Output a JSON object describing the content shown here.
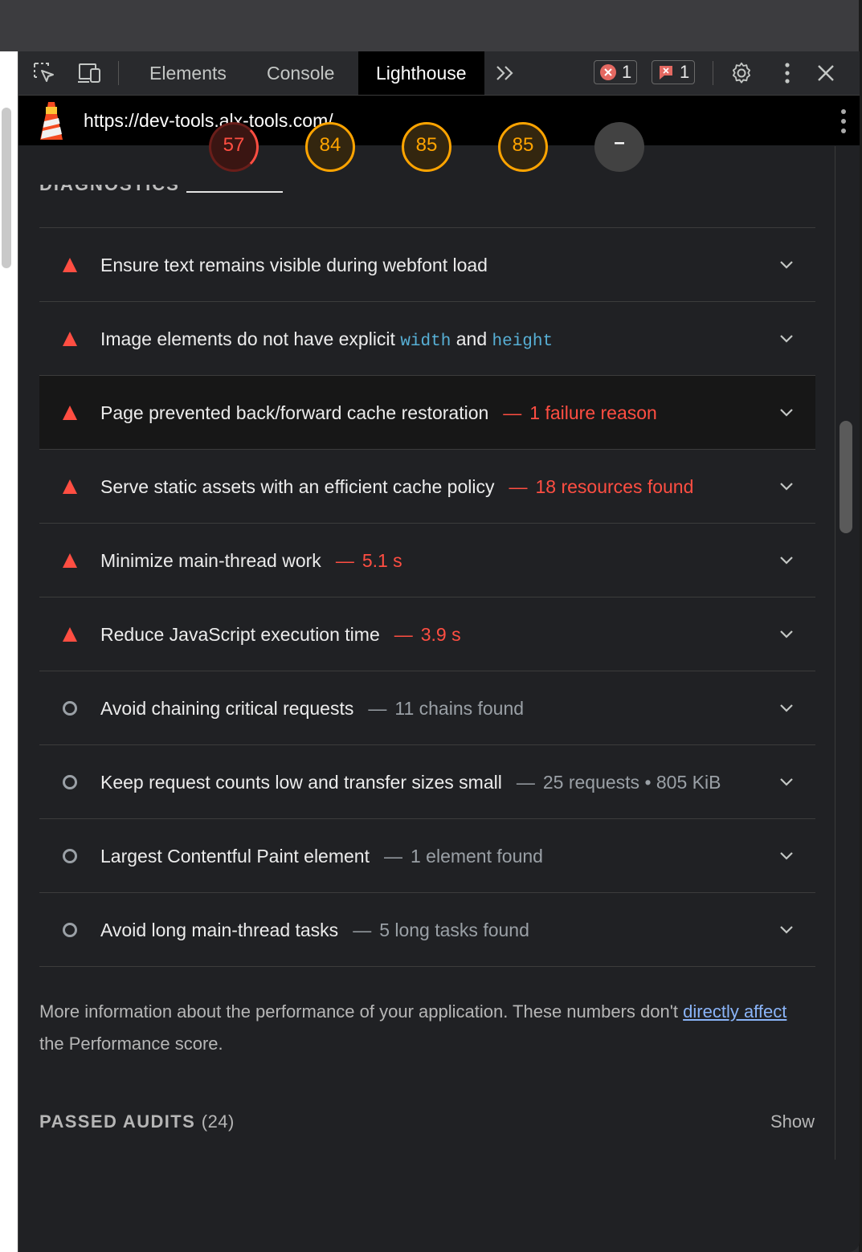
{
  "tabs": [
    {
      "label": "Elements"
    },
    {
      "label": "Console"
    },
    {
      "label": "Lighthouse"
    }
  ],
  "active_tab": "Lighthouse",
  "badges": {
    "errors": "1",
    "issues": "1"
  },
  "url": "https://dev-tools.alx-tools.com/",
  "scores": [
    "57",
    "84",
    "85",
    "85",
    "–"
  ],
  "section_heading": "DIAGNOSTICS",
  "audits": [
    {
      "title": "Ensure text remains visible during webfont load",
      "display": "",
      "severity": "fail"
    },
    {
      "title_parts": [
        "Image elements do not have explicit ",
        "width",
        " and ",
        "height"
      ],
      "severity": "fail"
    },
    {
      "title": "Page prevented back/forward cache restoration",
      "display": "1 failure reason",
      "severity": "fail"
    },
    {
      "title": "Serve static assets with an efficient cache policy",
      "display": "18 resources found",
      "severity": "fail"
    },
    {
      "title": "Minimize main-thread work",
      "display": "5.1 s",
      "severity": "fail"
    },
    {
      "title": "Reduce JavaScript execution time",
      "display": "3.9 s",
      "severity": "fail"
    },
    {
      "title": "Avoid chaining critical requests",
      "display": "11 chains found",
      "severity": "info"
    },
    {
      "title": "Keep request counts low and transfer sizes small",
      "display": "25 requests • 805 KiB",
      "severity": "info"
    },
    {
      "title": "Largest Contentful Paint element",
      "display": "1 element found",
      "severity": "info"
    },
    {
      "title": "Avoid long main-thread tasks",
      "display": "5 long tasks found",
      "severity": "info"
    }
  ],
  "dash": "—",
  "description": {
    "before": "More information about the performance of your application. These numbers don't ",
    "link": "directly affect",
    "after": " the Performance score."
  },
  "passed": {
    "label": "PASSED AUDITS",
    "count": "(24)",
    "show": "Show"
  },
  "colors": {
    "fail": "#ff4e42",
    "average": "#ffa400",
    "code": "#57b0d6",
    "link": "#8ab4f8"
  }
}
